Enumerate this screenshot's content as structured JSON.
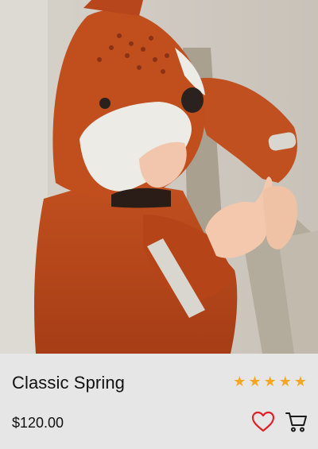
{
  "product": {
    "title": "Classic Spring",
    "price": "$120.00",
    "rating": {
      "value": 5,
      "max": 5
    },
    "image_alt": "Child in orange fox hooded jacket pointing"
  },
  "icons": {
    "star": "star-icon",
    "favorite": "heart-outline-icon",
    "cart": "shopping-cart-icon"
  },
  "colors": {
    "info_background": "#e6e6e6",
    "star": "#f5a623",
    "heart": "#e0202a",
    "jacket": "#b8461c"
  }
}
